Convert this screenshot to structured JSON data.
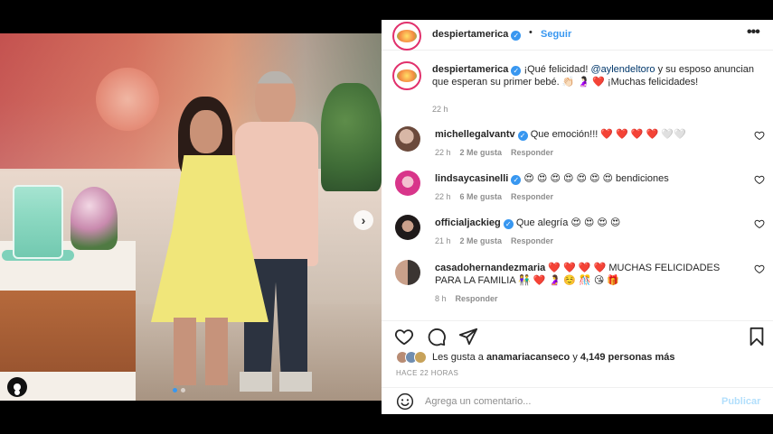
{
  "header": {
    "username": "despiertamerica",
    "separator": "•",
    "follow_label": "Seguir",
    "more_label": "•••"
  },
  "caption": {
    "username": "despiertamerica",
    "text_before": "¡Qué felicidad!",
    "mention": "@aylendeltoro",
    "text_after": "y su esposo anuncian que esperan su primer bebé. 👏🏻 🤰🏻 ❤️ ¡Muchas felicidades!",
    "time": "22 h"
  },
  "comments": [
    {
      "username": "michellegalvantv",
      "verified": true,
      "text": "Que emoción!!! ❤️ ❤️ ❤️ ❤️ 🤍🤍",
      "time": "22 h",
      "likes": "2 Me gusta",
      "reply": "Responder"
    },
    {
      "username": "lindsaycasinelli",
      "verified": true,
      "text": "😍 😍 😍 😍 😍 😍 😍 bendiciones",
      "time": "22 h",
      "likes": "6 Me gusta",
      "reply": "Responder"
    },
    {
      "username": "officialjackieg",
      "verified": true,
      "text": "Que alegría 😍 😍 😍 😍",
      "time": "21 h",
      "likes": "2 Me gusta",
      "reply": "Responder"
    },
    {
      "username": "casadohernandezmaria",
      "verified": false,
      "text": "❤️ ❤️ ❤️ ❤️ MUCHAS FELICIDADES PARA LA FAMILIA 👫 ❤️ 🤰 ☺️ 🎊 😘 🎁",
      "time": "8 h",
      "likes": "",
      "reply": "Responder"
    }
  ],
  "likes": {
    "prefix": "Les gusta a",
    "user": "anamariacanseco",
    "joiner": "y",
    "count_text": "4,149 personas más"
  },
  "post_time": "HACE 22 HORAS",
  "comment_box": {
    "placeholder": "Agrega un comentario...",
    "publish_label": "Publicar"
  },
  "colors": {
    "accent": "#3897f0",
    "publish_disabled": "#b2dffc",
    "heart": "#ed4956"
  },
  "carousel": {
    "slide_count": 2,
    "current": 1
  },
  "icons": {
    "like": "heart-icon",
    "comment": "comment-icon",
    "share": "paper-plane-icon",
    "save": "bookmark-icon",
    "emoji": "smiley-icon",
    "next": "chevron-right-icon",
    "tags": "user-tag-icon"
  }
}
